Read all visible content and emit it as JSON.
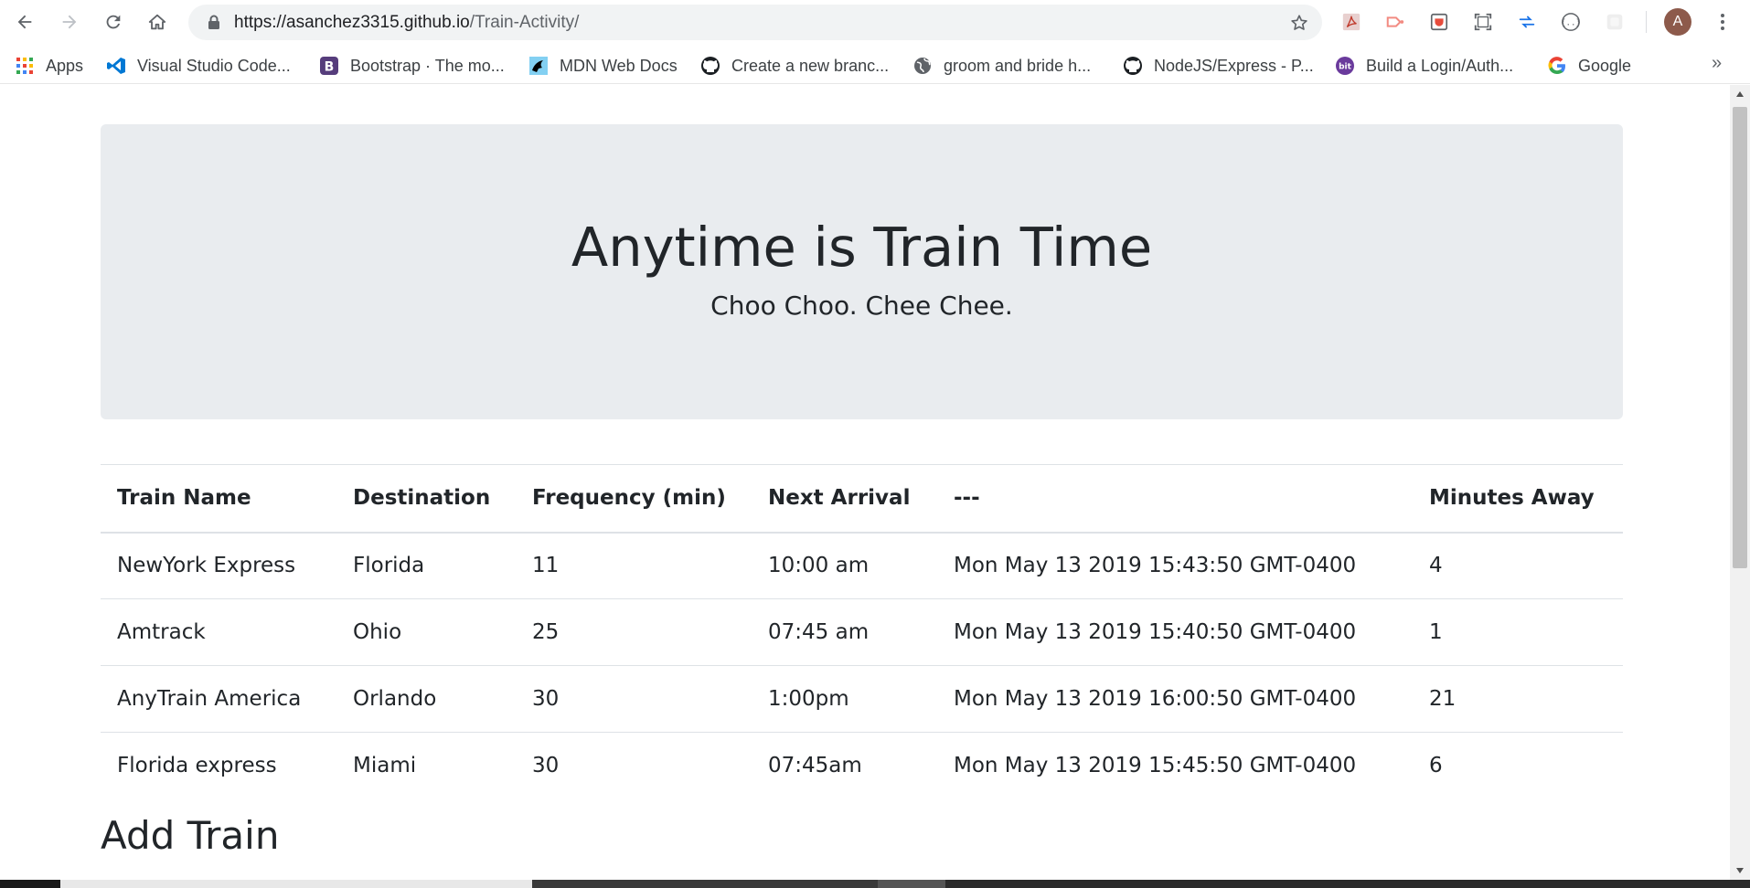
{
  "browser": {
    "url_host": "https://asanchez3315.github.io",
    "url_path": "/Train-Activity/",
    "avatar_letter": "A",
    "bookmarks": [
      {
        "label": "Apps",
        "icon": "apps-grid-icon"
      },
      {
        "label": "Visual Studio Code...",
        "icon": "vscode-icon"
      },
      {
        "label": "Bootstrap · The mo...",
        "icon": "bootstrap-icon"
      },
      {
        "label": "MDN Web Docs",
        "icon": "mdn-icon"
      },
      {
        "label": "Create a new branc...",
        "icon": "github-icon"
      },
      {
        "label": "groom and bride h...",
        "icon": "globe-icon"
      },
      {
        "label": "NodeJS/Express - P...",
        "icon": "github-icon"
      },
      {
        "label": "Build a Login/Auth...",
        "icon": "bit-icon"
      },
      {
        "label": "Google",
        "icon": "google-icon"
      }
    ],
    "more_bookmarks": "»"
  },
  "page": {
    "title": "Anytime is Train Time",
    "subtitle": "Choo Choo. Chee Chee.",
    "table": {
      "headers": [
        "Train Name",
        "Destination",
        "Frequency (min)",
        "Next Arrival",
        "---",
        "Minutes Away"
      ],
      "rows": [
        [
          "NewYork Express",
          "Florida",
          "11",
          "10:00 am",
          "Mon May 13 2019 15:43:50 GMT-0400",
          "4"
        ],
        [
          "Amtrack",
          "Ohio",
          "25",
          "07:45 am",
          "Mon May 13 2019 15:40:50 GMT-0400",
          "1"
        ],
        [
          "AnyTrain America",
          "Orlando",
          "30",
          "1:00pm",
          "Mon May 13 2019 16:00:50 GMT-0400",
          "21"
        ],
        [
          "Florida express",
          "Miami",
          "30",
          "07:45am",
          "Mon May 13 2019 15:45:50 GMT-0400",
          "6"
        ]
      ]
    },
    "add_heading": "Add Train"
  }
}
